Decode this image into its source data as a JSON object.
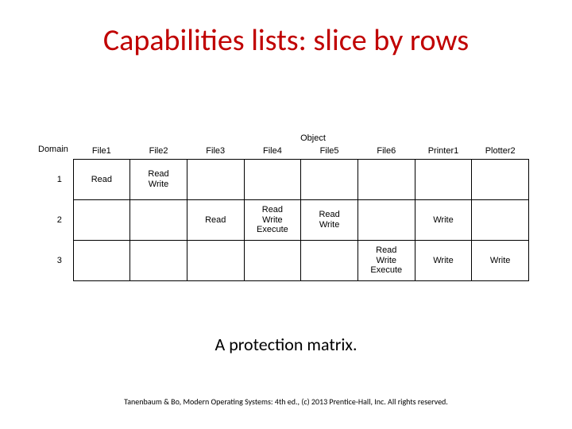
{
  "title": "Capabilities lists: slice by rows",
  "axis": {
    "columns": "Object",
    "rows": "Domain"
  },
  "columns": [
    "File1",
    "File2",
    "File3",
    "File4",
    "File5",
    "File6",
    "Printer1",
    "Plotter2"
  ],
  "rows": [
    "1",
    "2",
    "3"
  ],
  "cells": {
    "r0c0": "Read",
    "r0c1_a": "Read",
    "r0c1_b": "Write",
    "r1c2": "Read",
    "r1c3_a": "Read",
    "r1c3_b": "Write",
    "r1c3_c": "Execute",
    "r1c4_a": "Read",
    "r1c4_b": "Write",
    "r1c6": "Write",
    "r2c5_a": "Read",
    "r2c5_b": "Write",
    "r2c5_c": "Execute",
    "r2c6": "Write",
    "r2c7": "Write"
  },
  "caption": "A protection matrix.",
  "footer": "Tanenbaum & Bo, Modern Operating Systems: 4th ed., (c) 2013 Prentice-Hall, Inc. All rights reserved.",
  "chart_data": {
    "type": "table",
    "title": "A protection matrix",
    "row_axis": "Domain",
    "column_axis": "Object",
    "columns": [
      "File1",
      "File2",
      "File3",
      "File4",
      "File5",
      "File6",
      "Printer1",
      "Plotter2"
    ],
    "rows": [
      "1",
      "2",
      "3"
    ],
    "data": [
      [
        "Read",
        "Read Write",
        "",
        "",
        "",
        "",
        "",
        ""
      ],
      [
        "",
        "",
        "Read",
        "Read Write Execute",
        "Read Write",
        "",
        "Write",
        ""
      ],
      [
        "",
        "",
        "",
        "",
        "",
        "Read Write Execute",
        "Write",
        "Write"
      ]
    ]
  }
}
